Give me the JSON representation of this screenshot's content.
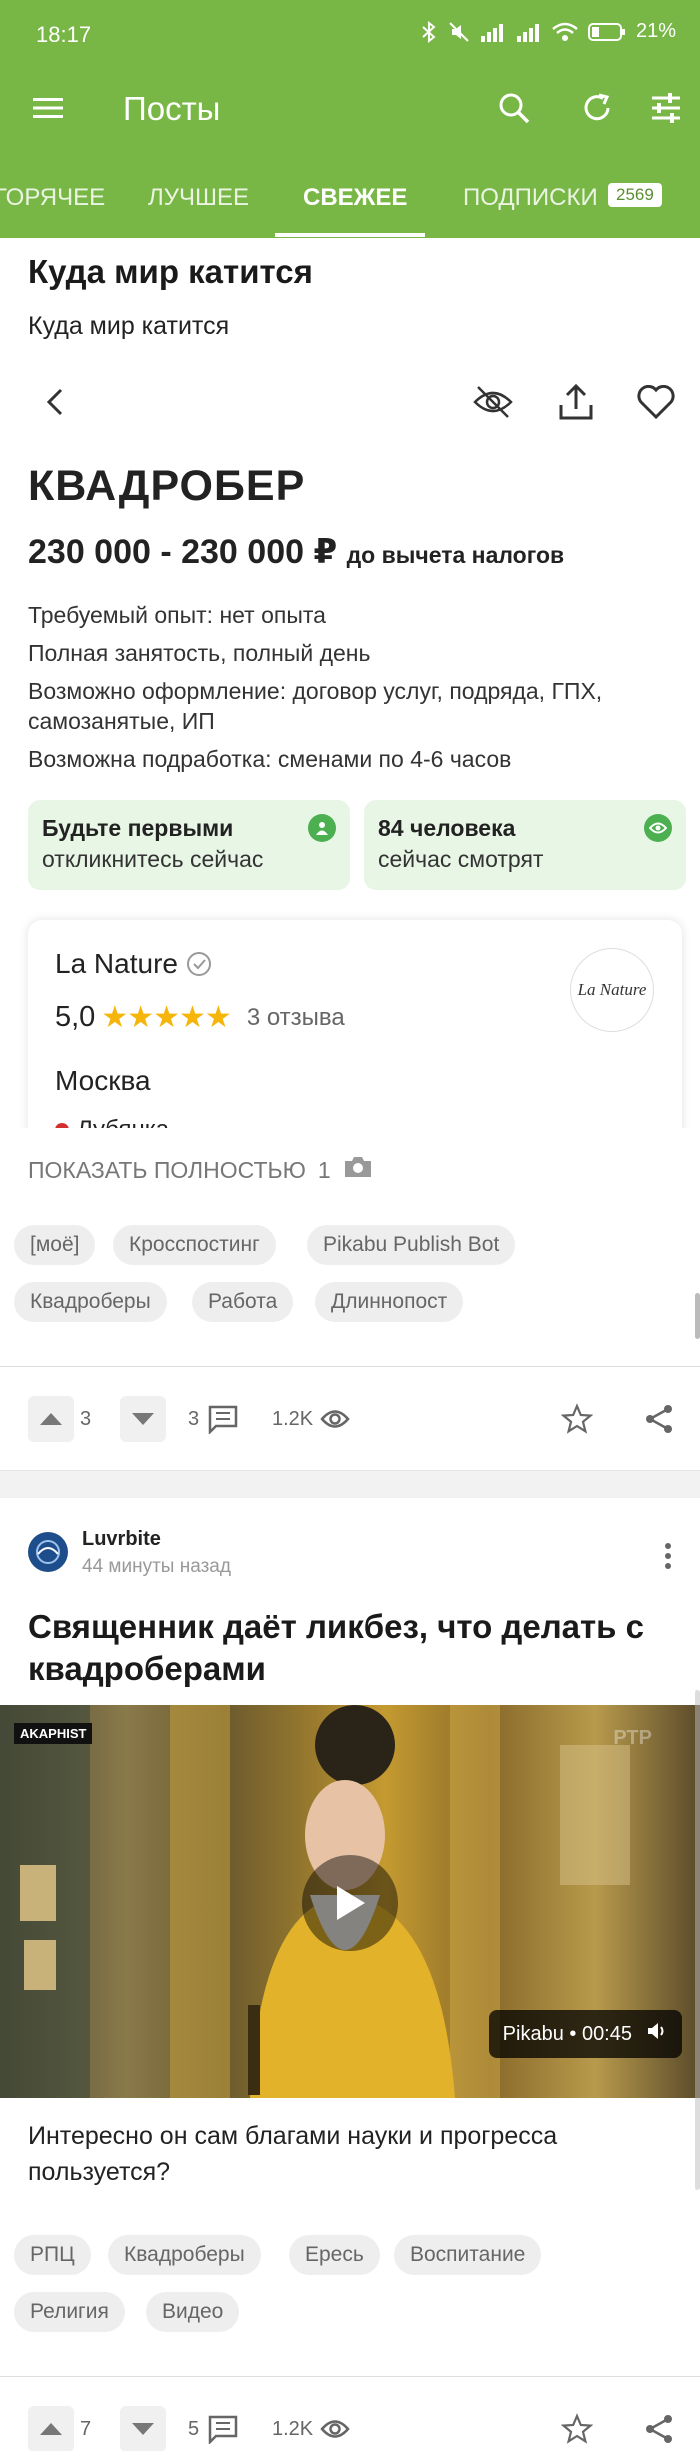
{
  "status_bar": {
    "time": "18:17",
    "battery": "21%"
  },
  "toolbar": {
    "title": "Посты"
  },
  "tabs": [
    {
      "label": "ГОРЯЧЕЕ"
    },
    {
      "label": "ЛУЧШЕЕ"
    },
    {
      "label": "СВЕЖЕЕ",
      "active": true
    },
    {
      "label": "ПОДПИСКИ",
      "badge": "2569"
    }
  ],
  "post1": {
    "title": "Куда мир катится",
    "text": "Куда мир катится",
    "vacancy": {
      "title": "КВАДРОБЕР",
      "salary": "230 000 - 230 000 ₽",
      "salary_note": "до вычета налогов",
      "requirements": [
        "Требуемый опыт: нет опыта",
        "Полная занятость, полный день",
        "Возможно оформление: договор услуг, подряда, ГПХ, самозанятые, ИП",
        "Возможна подработка: сменами по 4-6 часов"
      ],
      "chips": [
        {
          "line1": "Будьте первыми",
          "line2": "откликнитесь сейчас"
        },
        {
          "line1": "84 человека",
          "line2": "сейчас смотрят"
        }
      ],
      "company": {
        "name": "La Nature",
        "rating": "5,0",
        "stars": 5,
        "reviews": "3 отзыва",
        "logo_text": "La Nature",
        "city": "Москва",
        "metro": "Лубянка"
      }
    },
    "show_full": {
      "label": "ПОКАЗАТЬ ПОЛНОСТЬЮ",
      "count": "1"
    },
    "tags": [
      "[моё]",
      "Кросспостинг",
      "Pikabu Publish Bot",
      "Квадроберы",
      "Работа",
      "Длиннопост"
    ],
    "actions": {
      "upvotes": "3",
      "comments": "3",
      "views": "1.2K"
    }
  },
  "post2": {
    "author": "Luvrbite",
    "time": "44 минуты назад",
    "title": "Священник даёт ликбез, что делать с квадроберами",
    "video": {
      "channel": "AKAPHIST",
      "duration": "Pikabu • 00:45"
    },
    "text": "Интересно он сам благами науки и прогресса пользуется?",
    "tags": [
      "РПЦ",
      "Квадроберы",
      "Ересь",
      "Воспитание",
      "Религия",
      "Видео"
    ],
    "actions": {
      "upvotes": "7",
      "comments": "5",
      "views": "1.2K"
    }
  },
  "colors": {
    "brand_green": "#78b745",
    "chip_bg": "#e8f6e6",
    "star": "#f5b50a"
  }
}
